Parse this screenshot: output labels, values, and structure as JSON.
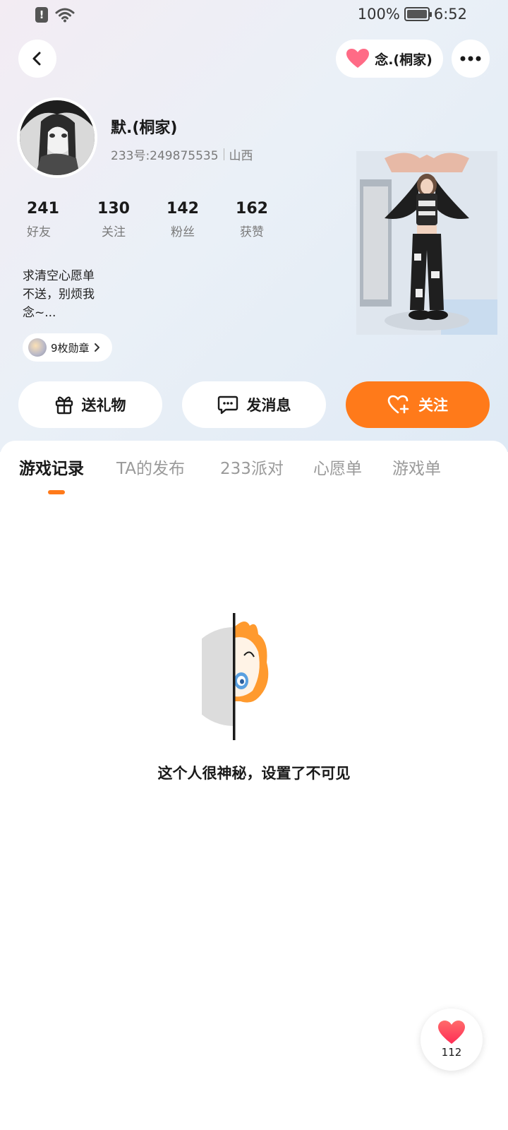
{
  "status_bar": {
    "battery": "100%",
    "time": "6:52"
  },
  "nav": {
    "family_chip_label": "念.(桐家)"
  },
  "profile": {
    "nickname": "默.(桐家)",
    "uid": "233号:249875535",
    "region": "山西",
    "stats": [
      {
        "value": "241",
        "label": "好友"
      },
      {
        "value": "130",
        "label": "关注"
      },
      {
        "value": "142",
        "label": "粉丝"
      },
      {
        "value": "162",
        "label": "获赞"
      }
    ],
    "bio_lines": [
      "求清空心愿单",
      "不送，别烦我",
      "念~..."
    ],
    "badges_label": "9枚勋章"
  },
  "actions": {
    "gift": "送礼物",
    "message": "发消息",
    "follow": "关注"
  },
  "tabs": [
    {
      "label": "游戏记录",
      "active": true
    },
    {
      "label": "TA的发布",
      "active": false
    },
    {
      "label": "233派对",
      "active": false
    },
    {
      "label": "心愿单",
      "active": false
    },
    {
      "label": "游戏单",
      "active": false
    }
  ],
  "empty_state": {
    "message": "这个人很神秘，设置了不可见"
  },
  "like_button": {
    "count": "112"
  },
  "colors": {
    "accent": "#ff7a1a",
    "heart": "#ff4d5e"
  },
  "icons": {
    "alert": "alert-icon",
    "wifi": "wifi-icon",
    "battery": "battery-icon",
    "back": "back-arrow-icon",
    "heart": "heart-icon",
    "more": "more-dots-icon",
    "gift": "gift-icon",
    "message": "message-icon",
    "follow": "heart-plus-icon",
    "chevron": "chevron-right-icon"
  }
}
